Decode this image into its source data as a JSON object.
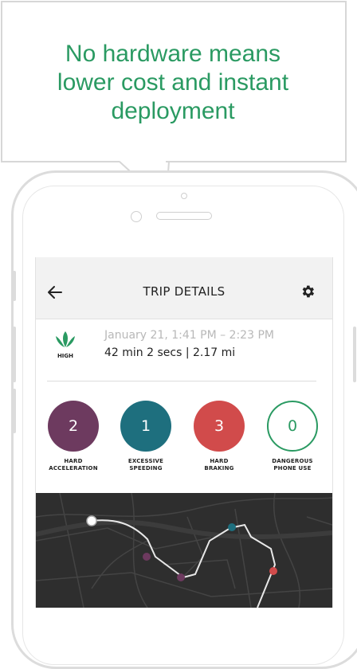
{
  "callout": {
    "lines": [
      "No hardware means",
      "lower cost and instant",
      "deployment"
    ]
  },
  "header": {
    "title": "TRIP DETAILS",
    "back_icon": "arrow-left-icon",
    "settings_icon": "gear-icon"
  },
  "trip": {
    "risk_label": "HIGH",
    "date_range": "January 21, 1:41 PM – 2:23 PM",
    "duration_distance": "42 min 2 secs | 2.17 mi"
  },
  "events": [
    {
      "count": "2",
      "label_line1": "HARD",
      "label_line2": "ACCELERATION",
      "color": "#6d3a5f"
    },
    {
      "count": "1",
      "label_line1": "EXCESSIVE",
      "label_line2": "SPEEDING",
      "color": "#1e6f7e"
    },
    {
      "count": "3",
      "label_line1": "HARD",
      "label_line2": "BRAKING",
      "color": "#d14b4b"
    },
    {
      "count": "0",
      "label_line1": "DANGEROUS",
      "label_line2": "PHONE USE",
      "color": "#2a9a62"
    }
  ],
  "colors": {
    "accent_green": "#2a9a62",
    "map_background": "#2e2e2e"
  }
}
